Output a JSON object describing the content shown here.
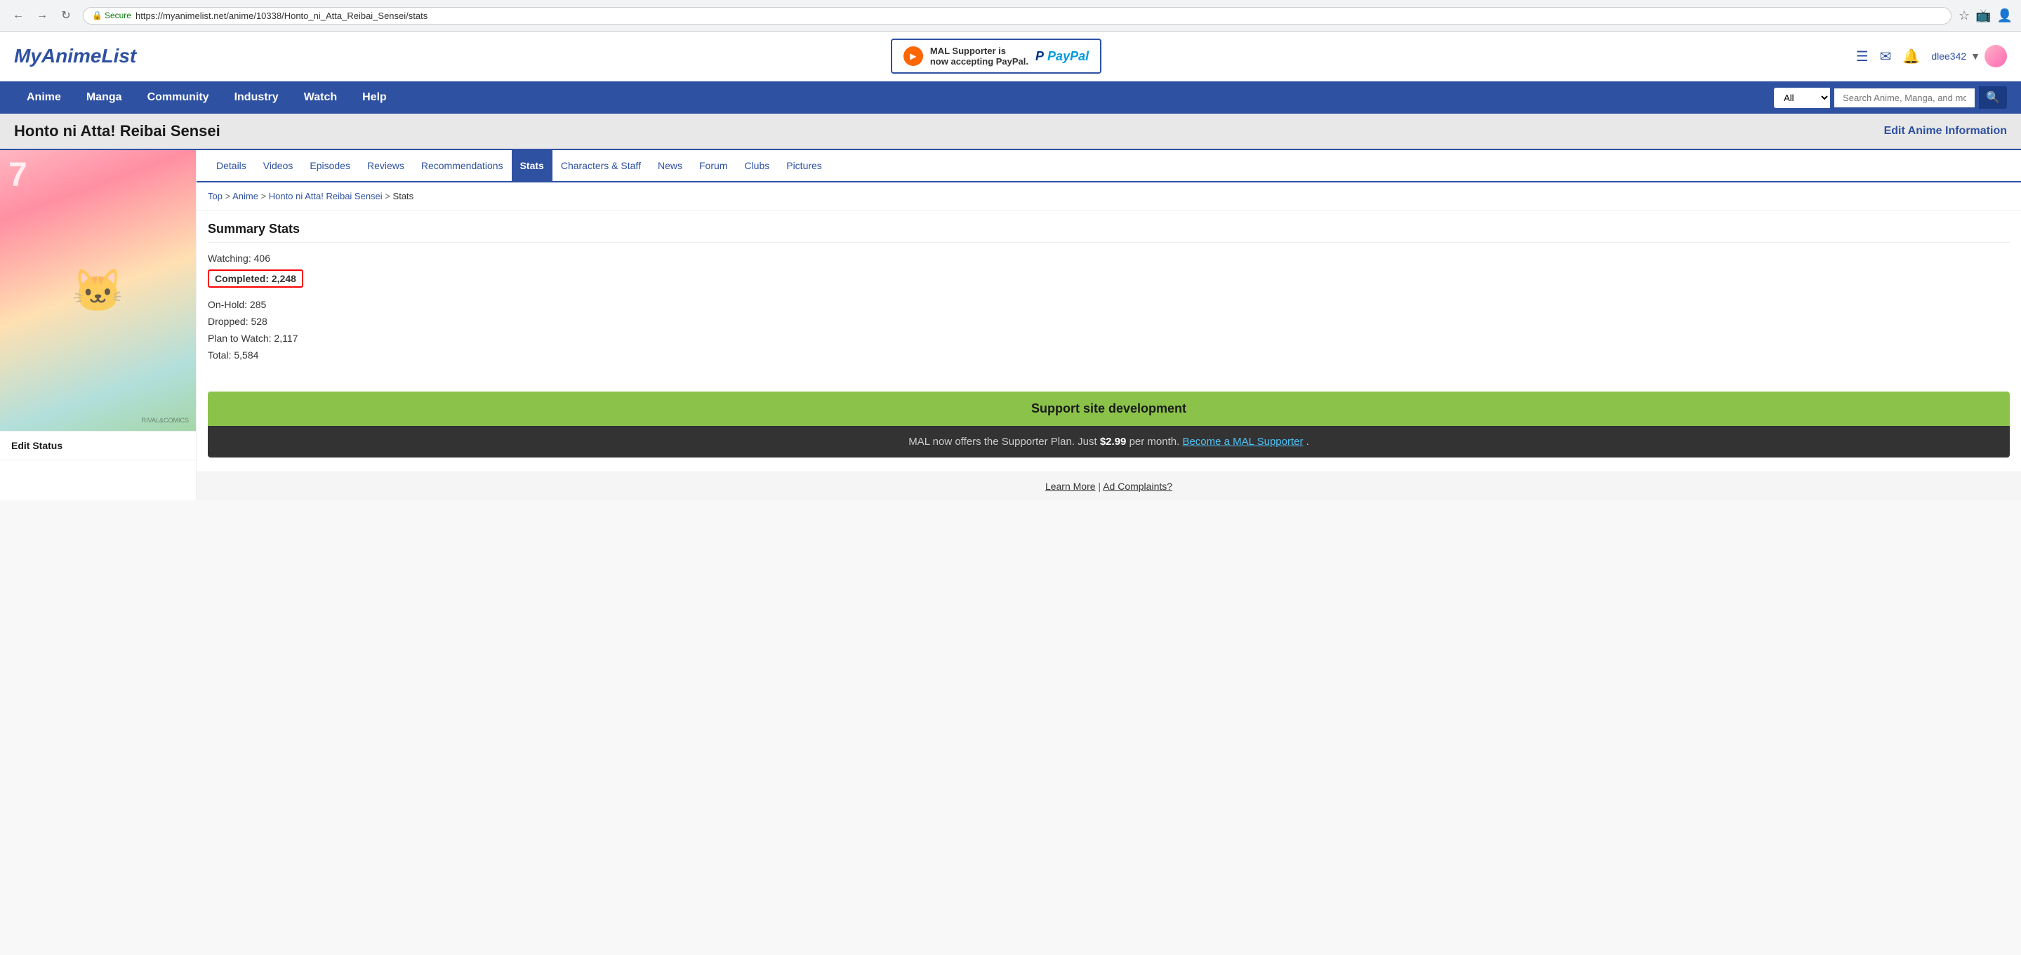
{
  "browser": {
    "url": "https://myanimelist.net/anime/10338/Honto_ni_Atta_Reibai_Sensei/stats",
    "secure_label": "Secure"
  },
  "header": {
    "logo": "MyAnimeList",
    "banner": {
      "text1": "MAL Supporter is",
      "text2": "now accepting PayPal.",
      "paypal_label": "P PayPal"
    },
    "icons": {
      "menu": "☰",
      "mail": "✉",
      "bell": "🔔"
    },
    "user": {
      "name": "dlee342",
      "dropdown": "▼"
    }
  },
  "nav": {
    "links": [
      "Anime",
      "Manga",
      "Community",
      "Industry",
      "Watch",
      "Help"
    ],
    "search": {
      "select_default": "All",
      "placeholder": "Search Anime, Manga, and more...",
      "btn_icon": "🔍"
    }
  },
  "page_title": {
    "title": "Honto ni Atta! Reibai Sensei",
    "edit_link": "Edit Anime Information"
  },
  "tabs": [
    {
      "label": "Details",
      "active": false
    },
    {
      "label": "Videos",
      "active": false
    },
    {
      "label": "Episodes",
      "active": false
    },
    {
      "label": "Reviews",
      "active": false
    },
    {
      "label": "Recommendations",
      "active": false
    },
    {
      "label": "Stats",
      "active": true
    },
    {
      "label": "Characters & Staff",
      "active": false
    },
    {
      "label": "News",
      "active": false
    },
    {
      "label": "Forum",
      "active": false
    },
    {
      "label": "Clubs",
      "active": false
    },
    {
      "label": "Pictures",
      "active": false
    }
  ],
  "breadcrumb": {
    "items": [
      "Top",
      "Anime",
      "Honto ni Atta! Reibai Sensei",
      "Stats"
    ],
    "separators": [
      ">",
      ">",
      ">"
    ]
  },
  "stats": {
    "title": "Summary Stats",
    "rows": [
      {
        "label": "Watching:",
        "value": "406",
        "highlighted": false
      },
      {
        "label": "Completed:",
        "value": "2,248",
        "highlighted": true
      },
      {
        "label": "On-Hold:",
        "value": "285",
        "highlighted": false
      },
      {
        "label": "Dropped:",
        "value": "528",
        "highlighted": false
      },
      {
        "label": "Plan to Watch:",
        "value": "2,117",
        "highlighted": false
      },
      {
        "label": "Total:",
        "value": "5,584",
        "highlighted": false
      }
    ]
  },
  "support_banner": {
    "heading": "Support site development",
    "body_prefix": "MAL now offers the Supporter Plan. Just ",
    "price": "$2.99",
    "body_suffix": " per month. ",
    "link_text": "Become a MAL Supporter",
    "period": "."
  },
  "footer": {
    "learn_more": "Learn More",
    "separator": "|",
    "ad_complaints": "Ad Complaints?"
  },
  "sidebar": {
    "edit_status_label": "Edit Status"
  },
  "cover": {
    "number": "7"
  }
}
